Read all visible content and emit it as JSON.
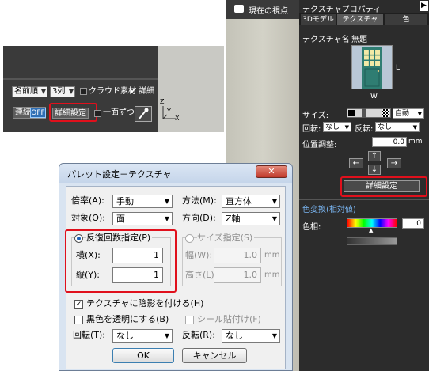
{
  "toolbar": {
    "sort_value": "名前順",
    "columns_value": "3列",
    "cloud_label": "クラウド素材",
    "detail_label": "詳細",
    "continuous_label": "連続",
    "continuous_state": "OFF",
    "detail_settings_button": "詳細設定",
    "one_side_label": "一面ずつ",
    "axis_z": "Z",
    "axis_y": "Y",
    "axis_x": "X"
  },
  "viewport": {
    "current_view_label": "現在の視点"
  },
  "texture_panel": {
    "title": "テクスチャプロパティ",
    "tabs": [
      "3Dモデル",
      "テクスチャ",
      "色"
    ],
    "texture_name_label": "テクスチャ名",
    "texture_name_value": "無題",
    "side_l": "L",
    "side_w": "W",
    "size_label": "サイズ:",
    "size_value": "自動",
    "rotate_label": "回転:",
    "rotate_value": "なし",
    "flip_label": "反転:",
    "flip_value": "なし",
    "position_label": "位置調整:",
    "position_value": "0.0",
    "position_unit": "mm",
    "detail_button": "詳細設定",
    "color_section": "色変換(相対値)",
    "hue_label": "色相:",
    "hue_value": "0"
  },
  "dialog": {
    "title": "パレット設定－テクスチャ",
    "ratio_label": "倍率(A):",
    "ratio_value": "手動",
    "method_label": "方法(M):",
    "method_value": "直方体",
    "target_label": "対象(O):",
    "target_value": "面",
    "direction_label": "方向(D):",
    "direction_value": "Z軸",
    "repeat_label": "反復回数指定(P)",
    "size_spec_label": "サイズ指定(S)",
    "horizontal_label": "横(X):",
    "horizontal_value": "1",
    "vertical_label": "縦(Y):",
    "vertical_value": "1",
    "width_label": "幅(W):",
    "width_value": "1.0",
    "height_label": "高さ(L):",
    "height_value": "1.0",
    "unit": "mm",
    "shadow_label": "テクスチャに陰影を付ける(H)",
    "black_transparent_label": "黒色を透明にする(B)",
    "seal_label": "シール貼付け(F)",
    "rotate_label": "回転(T):",
    "rotate_value": "なし",
    "flip_label": "反転(R):",
    "flip_value": "なし",
    "ok": "OK",
    "cancel": "キャンセル"
  }
}
